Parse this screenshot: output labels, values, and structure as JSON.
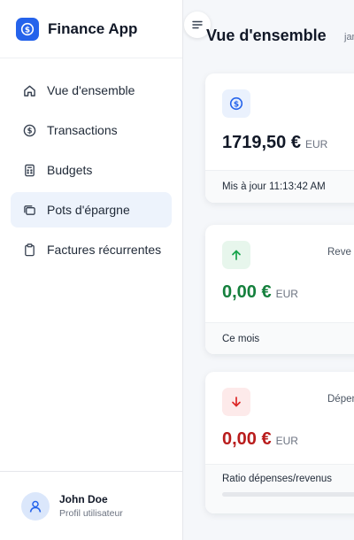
{
  "app": {
    "title": "Finance App"
  },
  "sidebar": {
    "items": [
      {
        "label": "Vue d'ensemble",
        "icon": "home-icon"
      },
      {
        "label": "Transactions",
        "icon": "dollar-circle-icon"
      },
      {
        "label": "Budgets",
        "icon": "calculator-icon"
      },
      {
        "label": "Pots d'épargne",
        "icon": "wallet-icon",
        "active": true
      },
      {
        "label": "Factures récurrentes",
        "icon": "clipboard-icon"
      }
    ]
  },
  "user": {
    "name": "John Doe",
    "role": "Profil utilisateur"
  },
  "header": {
    "title": "Vue d'ensemble",
    "date_fragment": "jan"
  },
  "cards": {
    "balance": {
      "amount": "1719,50 €",
      "currency": "EUR",
      "footer": "Mis à jour 11:13:42 AM",
      "accent": "#2563eb"
    },
    "income": {
      "label": "Reve",
      "amount": "0,00 €",
      "currency": "EUR",
      "footer": "Ce mois",
      "accent": "#16a34a"
    },
    "expenses": {
      "label": "Dépen",
      "amount": "0,00 €",
      "currency": "EUR",
      "footer": "Ratio dépenses/revenus",
      "accent": "#dc2626",
      "ratio": 0
    }
  },
  "colors": {
    "primary": "#2563eb",
    "active_bg": "#edf3fc",
    "positive": "#15803d",
    "negative": "#b91c1c"
  }
}
